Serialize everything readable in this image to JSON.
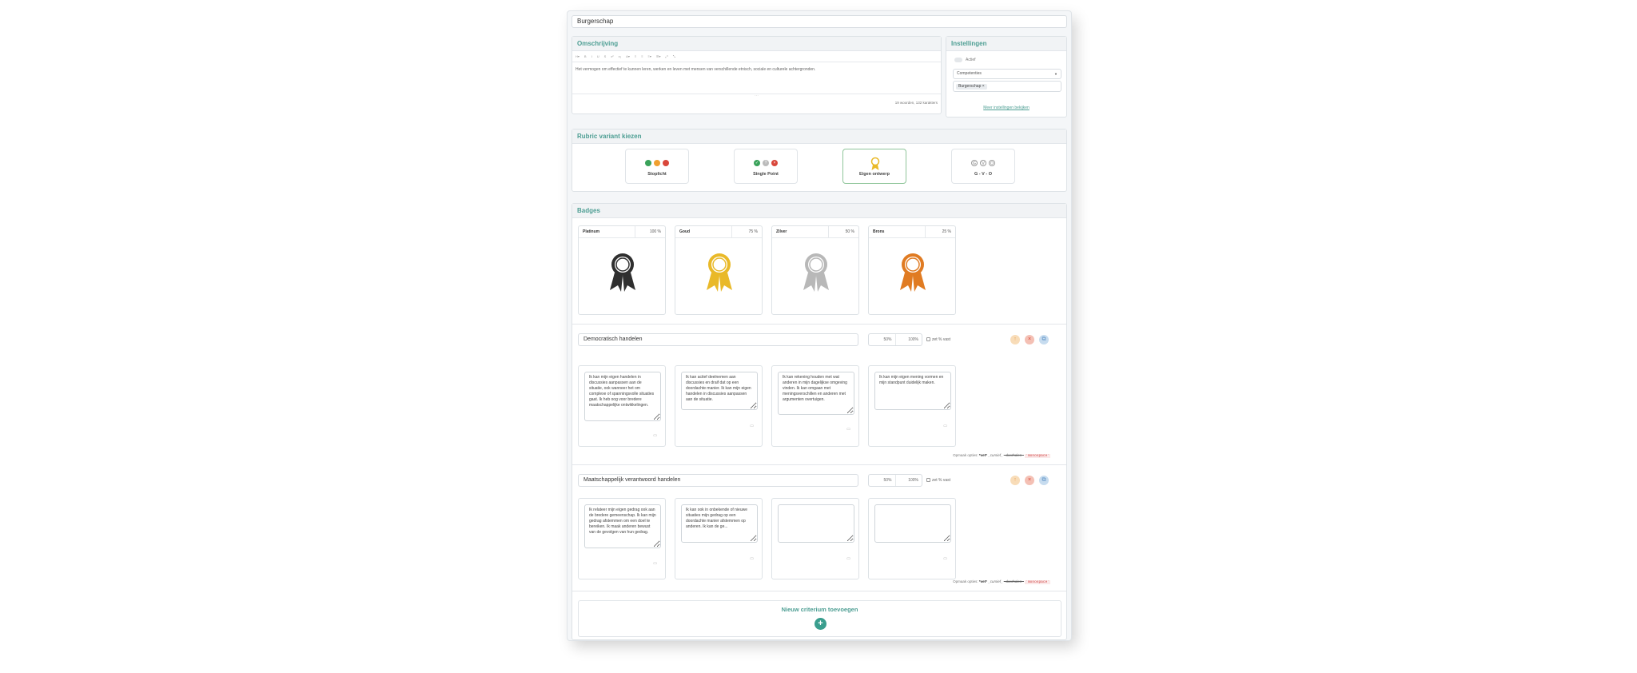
{
  "title_field": "Burgerschap",
  "description": {
    "header": "Omschrijving",
    "toolbar": [
      "H▾",
      "B",
      "I",
      "U",
      "S",
      "x²",
      "x₂",
      "A▾",
      "≡",
      "≡",
      "≡▾",
      "☰▾",
      "⤢",
      "⤡"
    ],
    "text": "Het vermogen om effectief te kunnen leren, werken en leven met mensen van verschillende etnisch, sociale en culturele achtergronden.",
    "counter": "19 woorden, 132 karakters"
  },
  "settings": {
    "header": "Instellingen",
    "active_label": "Actief",
    "select_value": "Competenties",
    "tag": "Burgerschap",
    "more_link": "Meer instellingen bekijken"
  },
  "variants": {
    "header": "Rubric variant kiezen",
    "items": [
      {
        "label": "Stoplicht",
        "selected": false
      },
      {
        "label": "Single Point",
        "selected": false
      },
      {
        "label": "Eigen ontwerp",
        "selected": true
      },
      {
        "label": "G - V - O",
        "selected": false
      }
    ],
    "gvo_letters": [
      "G",
      "V",
      "O"
    ]
  },
  "badges": {
    "header": "Badges",
    "items": [
      {
        "name": "Platinum",
        "percent": "100 %",
        "color": "#2f2f2f"
      },
      {
        "name": "Goud",
        "percent": "75 %",
        "color": "#e9b928"
      },
      {
        "name": "Zilver",
        "percent": "50 %",
        "color": "#b8b8b8"
      },
      {
        "name": "Brons",
        "percent": "25 %",
        "color": "#e07b22"
      }
    ]
  },
  "criteria": [
    {
      "name": "Democratisch handelen",
      "pct_value": "50%",
      "pct_total": "100%",
      "fixed_label": "zet % vast",
      "levels": [
        "Ik kan mijn eigen handelen in discussies aanpassen aan de situatie, ook wanneer het om complexe of spanningsvolle situaties gaat. Ik heb oog voor bredere maatschappelijke ontwikkelingen.",
        "Ik kan actief deelnemen aan discussies en draif dat op een doordachte manier. Ik kan mijn eigen handelen in discussies aanpassen aan de situatie.",
        "Ik kan rekening houden met wat anderen in mijn dagelijkse omgeving vinden. Ik kan omgaan met meningsverschillen en anderen met argumenten overtuigen.",
        "Ik kan mijn eigen mening vormen en mijn standpunt duidelijk maken."
      ]
    },
    {
      "name": "Maatschappelijk verantwoord handelen",
      "pct_value": "50%",
      "pct_total": "100%",
      "fixed_label": "zet % vast",
      "levels": [
        "Ik relateer mijn eigen gedrag ook aan de bredere gemeenschap. Ik kan mijn gedrag afstemmen om een doel te bereiken. Ik maak anderen bewust van de gevolgen van hun gedrag.",
        "Ik kan ook in onbekende of nieuwe situaties mijn gedrag op een doordachte manier afstemmen op anderen. Ik kan de ge...",
        "",
        ""
      ]
    }
  ],
  "format_options": {
    "label": "Opmaak opties:",
    "bold": "*vet*",
    "italic": "_cursief_",
    "strike": "~doorhalen~",
    "mono": "`monospace`"
  },
  "add_criterion": "Nieuw criterium toevoegen",
  "colors": {
    "accent": "#4d9e93",
    "green": "#3aa25a",
    "orange": "#f0a030",
    "red": "#d9473b"
  }
}
